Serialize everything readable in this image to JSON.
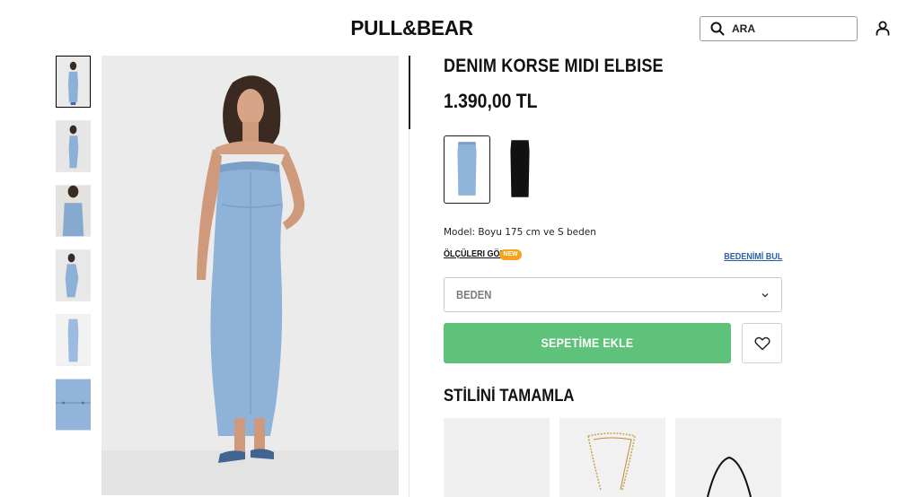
{
  "header": {
    "logo": "PULL&BEAR",
    "search_placeholder": "ARA",
    "search_icon": "search-icon",
    "user_icon": "user-icon"
  },
  "gallery": {
    "thumbnails": [
      {
        "alt": "thumbnail-front",
        "active": true
      },
      {
        "alt": "thumbnail-back",
        "active": false
      },
      {
        "alt": "thumbnail-closeup",
        "active": false
      },
      {
        "alt": "thumbnail-pose",
        "active": false
      },
      {
        "alt": "thumbnail-flat",
        "active": false
      },
      {
        "alt": "thumbnail-detail",
        "active": false
      }
    ]
  },
  "product": {
    "title": "DENIM KORSE MIDI ELBISE",
    "price": "1.390,00 TL",
    "colors": [
      {
        "name": "light-denim",
        "hex": "#8fb4d9",
        "selected": true
      },
      {
        "name": "black",
        "hex": "#111111",
        "selected": false
      }
    ],
    "model_info": "Model: Boyu 175 cm ve S beden",
    "size_guide_label": "ÖLÇÜLERI GÖR",
    "new_badge": "NEW",
    "find_size_label": "BEDENİMİ BUL",
    "size_placeholder": "BEDEN",
    "add_to_cart": "SEPETİME EKLE",
    "wishlist_icon": "heart-icon"
  },
  "complete_look": {
    "title": "STİLİNİ TAMAMLA",
    "items": [
      "blank-item",
      "gold-necklace",
      "black-bag"
    ]
  },
  "colors": {
    "accent_green": "#5ec27a",
    "badge_orange": "#f7a21b",
    "link_blue": "#2b5fa8"
  }
}
